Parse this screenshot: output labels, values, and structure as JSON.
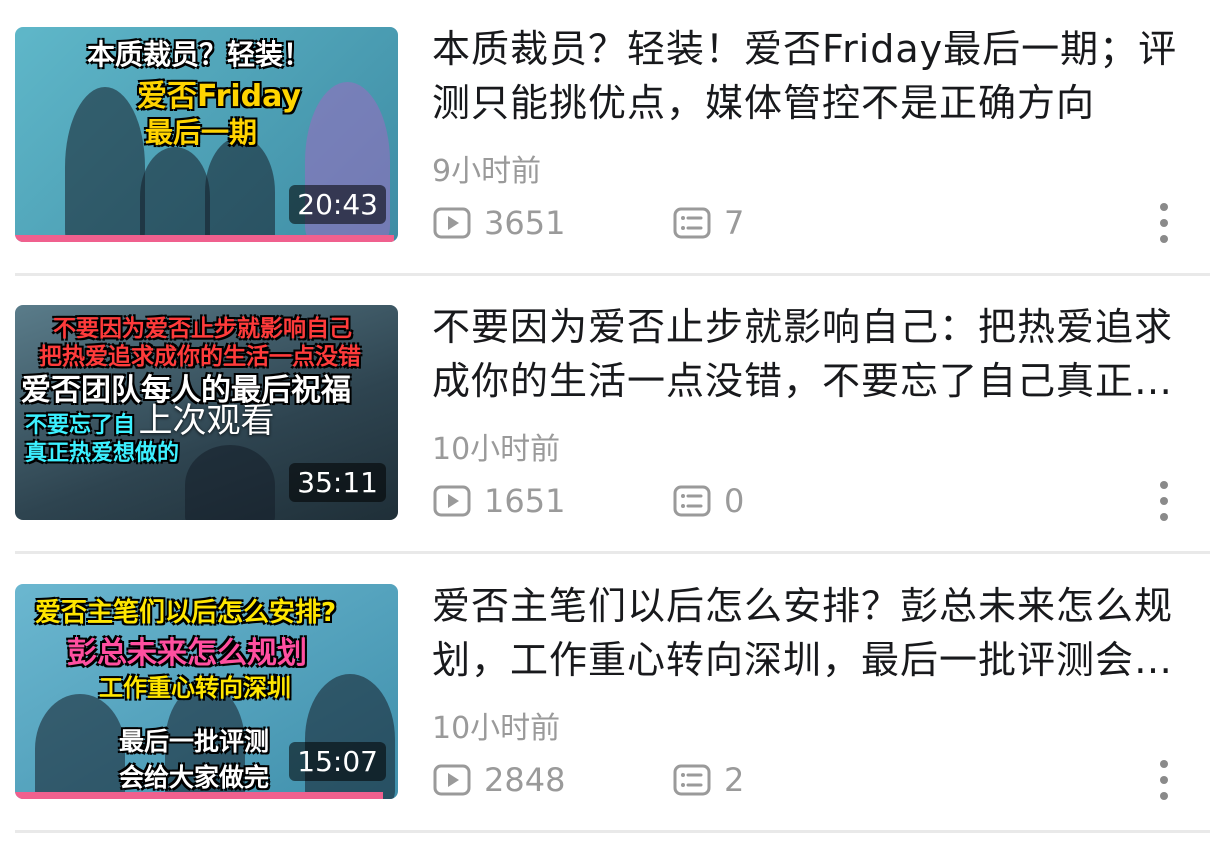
{
  "colors": {
    "progress": "#f0608e",
    "title": "#18191c",
    "meta": "#9a9a9a"
  },
  "videos": [
    {
      "title": "本质裁员？轻装！爱否Friday最后一期；评测只能挑优点，媒体管控不是正确方向",
      "time": "9小时前",
      "views": "3651",
      "comments": "7",
      "duration": "20:43",
      "progress_fraction": 0.99,
      "last_watched_label": "",
      "cover_text": [
        "本质裁员？轻装！",
        "爱否Friday",
        "最后一期"
      ]
    },
    {
      "title": "不要因为爱否止步就影响自己：把热爱追求成你的生活一点没错，不要忘了自己真正热爱想做的",
      "time": "10小时前",
      "views": "1651",
      "comments": "0",
      "duration": "35:11",
      "progress_fraction": 0,
      "last_watched_label": "上次观看",
      "cover_text": [
        "不要因为爱否止步就影响自己",
        "把热爱追求成你的生活一点没错",
        "爱否团队每人的最后祝福",
        "不要忘了自",
        "真正热爱想做的"
      ]
    },
    {
      "title": "爱否主笔们以后怎么安排？彭总未来怎么规划，工作重心转向深圳，最后一批评测会给大家做完",
      "time": "10小时前",
      "views": "2848",
      "comments": "2",
      "duration": "15:07",
      "progress_fraction": 0.96,
      "last_watched_label": "",
      "cover_text": [
        "爱否主笔们以后怎么安排?",
        "彭总未来怎么规划",
        "工作重心转向深圳",
        "最后一批评测",
        "会给大家做完"
      ]
    }
  ],
  "icons": {
    "views": "play-icon",
    "comments": "comment-icon",
    "more": "more-vertical-icon"
  }
}
